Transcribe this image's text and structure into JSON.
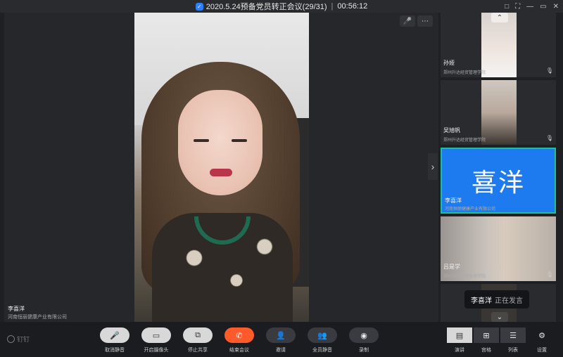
{
  "window": {
    "title": "2020.5.24预备党员转正会议(29/31)",
    "separator": "|",
    "timer": "00:56:12",
    "controls": [
      "□",
      "⛶",
      "—",
      "▭",
      "✕"
    ]
  },
  "stage": {
    "speaker_name": "李喜洋",
    "speaker_org": "河南恒丽健康产业有限公司",
    "tools": [
      "🎤",
      "⋯"
    ],
    "next_arrow": "›"
  },
  "participants": [
    {
      "name": "孙娅",
      "org": "郑州升达经贸管理学院",
      "mic": "🎙"
    },
    {
      "name": "吴旭帆",
      "org": "郑州升达经贸管理学院",
      "mic": "🎙"
    },
    {
      "name": "李喜洋",
      "org": "河南恒丽健康产业有限公司",
      "avatar_text": "喜洋",
      "active": true
    },
    {
      "name": "吕是学",
      "org": "郑州升达经贸管理学院",
      "mic": "🎙"
    }
  ],
  "scroll": {
    "up": "⌃",
    "down": "⌄"
  },
  "toast": {
    "name": "李喜洋",
    "status": "正在发言"
  },
  "logo": {
    "text": "钉钉"
  },
  "toolbar": {
    "buttons": [
      {
        "icon": "🎤",
        "label": "取消静音"
      },
      {
        "icon": "▭",
        "label": "开启摄像头"
      },
      {
        "icon": "⧉",
        "label": "停止共享"
      },
      {
        "icon": "✆",
        "label": "结束会议"
      },
      {
        "icon": "👤",
        "label": "邀请"
      },
      {
        "icon": "👥",
        "label": "全员静音"
      },
      {
        "icon": "◉",
        "label": "录制"
      }
    ],
    "views": [
      {
        "icon": "▤",
        "label": "演讲"
      },
      {
        "icon": "⊞",
        "label": "宫格"
      },
      {
        "icon": "☰",
        "label": "列表"
      }
    ],
    "settings": {
      "icon": "⚙",
      "label": "设置"
    }
  },
  "colors": {
    "accent_blue": "#1e7bef",
    "end_red": "#ff5a2a",
    "active_border": "#1fbf9a"
  }
}
